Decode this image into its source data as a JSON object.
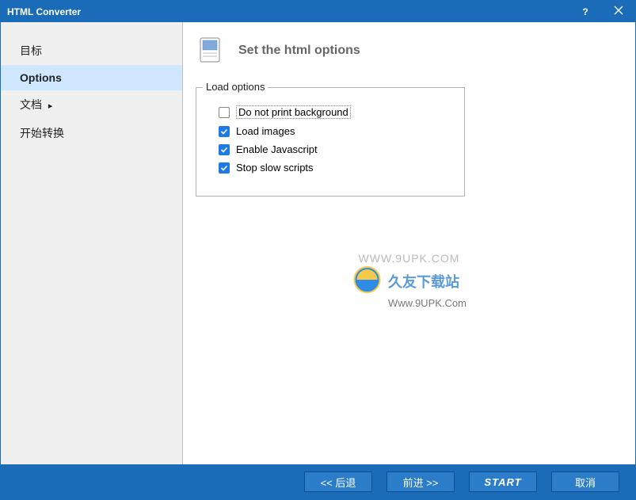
{
  "window": {
    "title": "HTML Converter"
  },
  "sidebar": {
    "items": [
      {
        "label": "目标",
        "selected": false,
        "has_submenu": false
      },
      {
        "label": "Options",
        "selected": true,
        "has_submenu": false
      },
      {
        "label": "文档",
        "selected": false,
        "has_submenu": true
      },
      {
        "label": "开始转换",
        "selected": false,
        "has_submenu": false
      }
    ]
  },
  "page": {
    "title": "Set the html options",
    "group_label": "Load options",
    "options": [
      {
        "label": "Do not print background",
        "checked": false,
        "highlighted": true
      },
      {
        "label": "Load images",
        "checked": true,
        "highlighted": false
      },
      {
        "label": "Enable Javascript",
        "checked": true,
        "highlighted": false
      },
      {
        "label": "Stop slow scripts",
        "checked": true,
        "highlighted": false
      }
    ]
  },
  "watermark": {
    "url_faint": "WWW.9UPK.COM",
    "title": "久友下载站",
    "url": "Www.9UPK.Com"
  },
  "footer": {
    "back": "<<  后退",
    "forward": "前进  >>",
    "start": "START",
    "cancel": "取消"
  }
}
